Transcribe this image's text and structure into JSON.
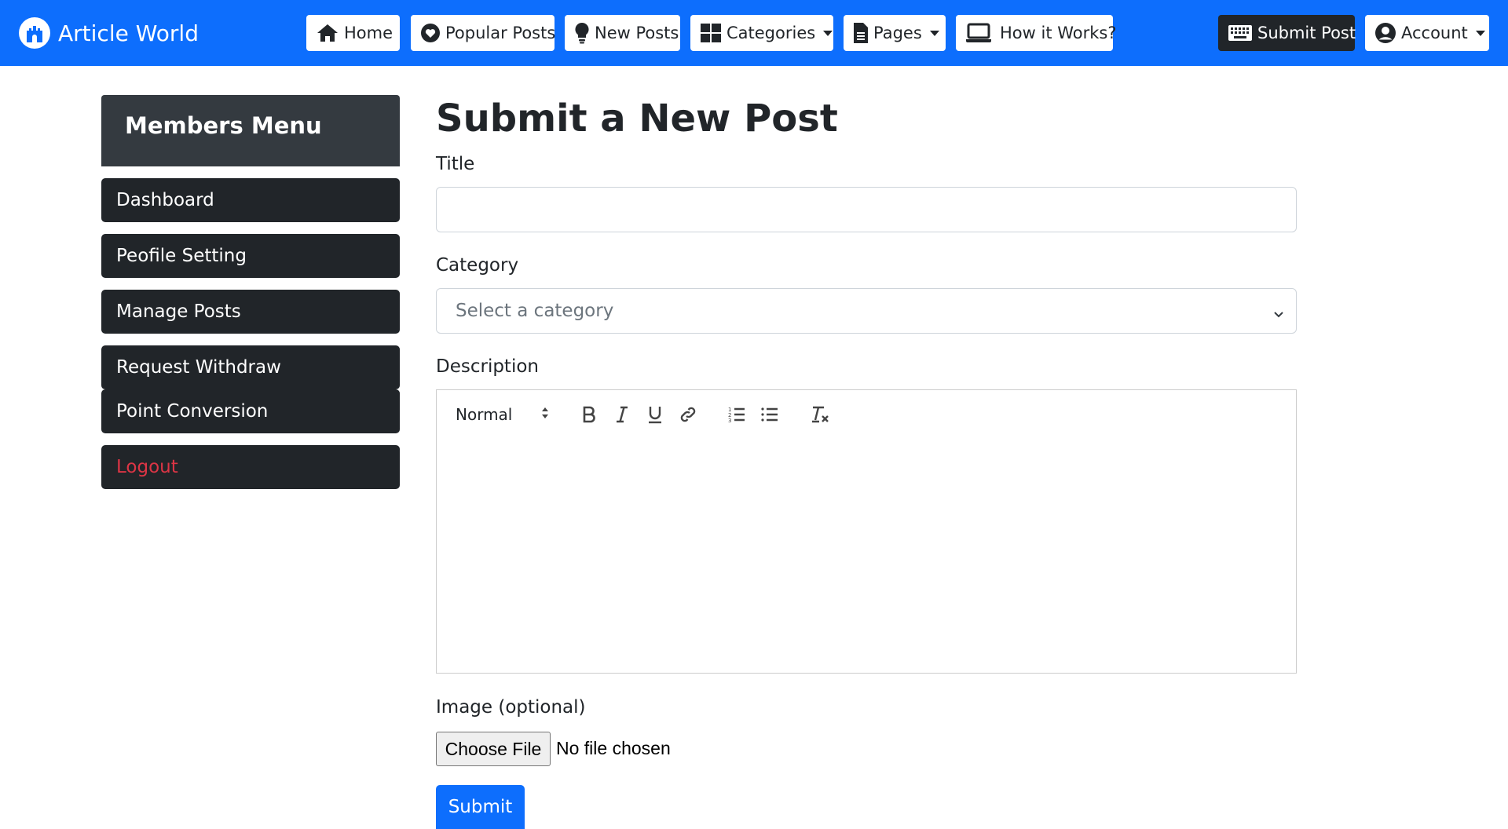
{
  "brand": {
    "name": "Article World",
    "icon": "castle-logo-icon"
  },
  "navbar": {
    "background": "#0d6efd",
    "items": [
      {
        "label": "Home",
        "icon": "home-icon"
      },
      {
        "label": "Popular Posts",
        "icon": "heart-icon"
      },
      {
        "label": "New Posts",
        "icon": "lightbulb-icon"
      },
      {
        "label": "Categories",
        "icon": "grid-icon",
        "dropdown": true
      },
      {
        "label": "Pages",
        "icon": "document-icon",
        "dropdown": true
      },
      {
        "label": "How it Works?",
        "icon": "laptop-icon"
      }
    ],
    "submit_post": {
      "label": "Submit Post",
      "icon": "keyboard-icon"
    },
    "account": {
      "label": "Account",
      "icon": "user-circle-icon",
      "dropdown": true
    }
  },
  "sidebar": {
    "title": "Members Menu",
    "items": [
      {
        "label": "Dashboard"
      },
      {
        "label": "Peofile Setting"
      },
      {
        "label": "Manage Posts"
      },
      {
        "label": "Request Withdraw"
      },
      {
        "label": "Point Conversion"
      },
      {
        "label": "Logout",
        "color": "#dc3545"
      }
    ]
  },
  "form": {
    "page_title": "Submit a New Post",
    "title_label": "Title",
    "title_value": "",
    "category_label": "Category",
    "category_selected": "Select a category",
    "description_label": "Description",
    "editor": {
      "format_value": "Normal",
      "tools": [
        "bold-icon",
        "italic-icon",
        "underline-icon",
        "link-icon",
        "ordered-list-icon",
        "bullet-list-icon",
        "clear-format-icon"
      ]
    },
    "image_label": "Image (optional)",
    "file_button": "Choose File",
    "file_status": "No file chosen",
    "submit_label": "Submit"
  }
}
